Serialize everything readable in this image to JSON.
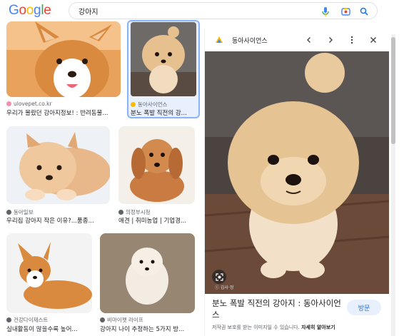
{
  "header": {
    "logo": [
      "G",
      "o",
      "o",
      "g",
      "l",
      "e"
    ],
    "query": "강아지",
    "icons": [
      "mic-icon",
      "lens-icon",
      "search-icon"
    ]
  },
  "results": [
    {
      "source": "ulovepet.co.kr",
      "caption": "우리가 몰랐던 강아지정보! : 반려동물..."
    },
    {
      "source": "동아사이언스",
      "caption": "분노 폭발 직전의 강..."
    },
    {
      "source": "동아일보",
      "caption": "우리집 강아지 작은 이유?...품종..."
    },
    {
      "source": "의정부시청",
      "caption": "애견 | 취미농업 | 기업경..."
    },
    {
      "source": "건강다이제스트",
      "caption": "실내활동이 많을수록 높어..."
    },
    {
      "source": "비마이펫 라이프",
      "caption": "강아지 나이 추정하는 5가지 방..."
    }
  ],
  "panel": {
    "site": "동아사이언스",
    "title": "분노 폭발 직전의 강아지 : 동아사이언스",
    "visit": "방문",
    "watermark": "ⓒ 김사·정",
    "notice_prefix": "저작권 보호를 받는 이미지일 수 있습니다.",
    "notice_link": "자세히 알아보기"
  },
  "colors": {
    "accent": "#1a73e8",
    "border": "#dfe1e5",
    "selected": "#8ab4f8"
  }
}
